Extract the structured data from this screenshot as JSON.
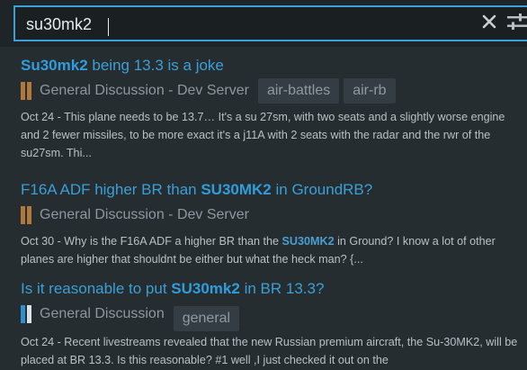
{
  "search": {
    "value": "su30mk2",
    "clear_icon": "close-icon",
    "filter_icon": "sliders-icon"
  },
  "results": [
    {
      "title_pre": "",
      "title_bold": "Su30mk2",
      "title_post": " being 13.3 is a joke",
      "category": "General Discussion - Dev Server",
      "category_colors": [
        "#b0783a",
        "#b0783a"
      ],
      "tags": [
        "air-battles",
        "air-rb"
      ],
      "blurb_pre": "Oct 24 - This plane needs to be 13.7… It's a su 27sm, with two seats and a slightly worse engine and 2 fewer missiles, to be more exact it's a j11A with 2 seats with the radar and the rwr of the su27sm. Thi...",
      "blurb_bold": "",
      "blurb_post": ""
    },
    {
      "title_pre": "F16A ADF higher BR than ",
      "title_bold": "SU30MK2",
      "title_post": " in GroundRB?",
      "category": "General Discussion - Dev Server",
      "category_colors": [
        "#b0783a",
        "#b0783a"
      ],
      "tags": [],
      "blurb_pre": "Oct 30 - Why is the F16A ADF a higher BR than the ",
      "blurb_bold": "SU30MK2",
      "blurb_post": " in Ground? I know a lot of other planes are higher that shouldnt be either but what the heck man? {..."
    },
    {
      "title_pre": "Is it reasonable to put ",
      "title_bold": "SU30mk2",
      "title_post": " in BR 13.3?",
      "category": "General Discussion",
      "category_colors": [
        "#2f8fd0",
        "#d8e4ea"
      ],
      "tags": [
        "general"
      ],
      "blurb_pre": "Oct 24 - Recent livestreams revealed that the new Russian premium aircraft, the Su-30MK2, will be placed at BR 13.3. Is this reasonable? #1 well ,I just checked it out on the",
      "blurb_bold": "",
      "blurb_post": ""
    }
  ]
}
